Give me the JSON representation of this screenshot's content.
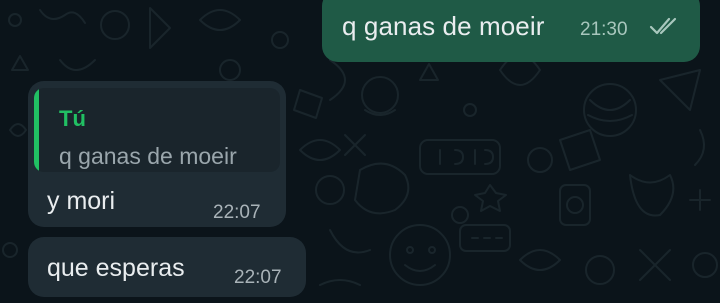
{
  "messages": [
    {
      "direction": "outgoing",
      "text": "q ganas de moeir",
      "time": "21:30",
      "status": "read"
    },
    {
      "direction": "incoming",
      "reply_to": {
        "author": "Tú",
        "text": "q ganas de moeir"
      },
      "text": "y mori",
      "time": "22:07"
    },
    {
      "direction": "incoming",
      "text": "que esperas",
      "time": "22:07"
    }
  ],
  "colors": {
    "background": "#0b141a",
    "outgoing_bubble": "#1f5a46",
    "incoming_bubble": "#1f2c34",
    "quote_accent": "#21c063"
  }
}
